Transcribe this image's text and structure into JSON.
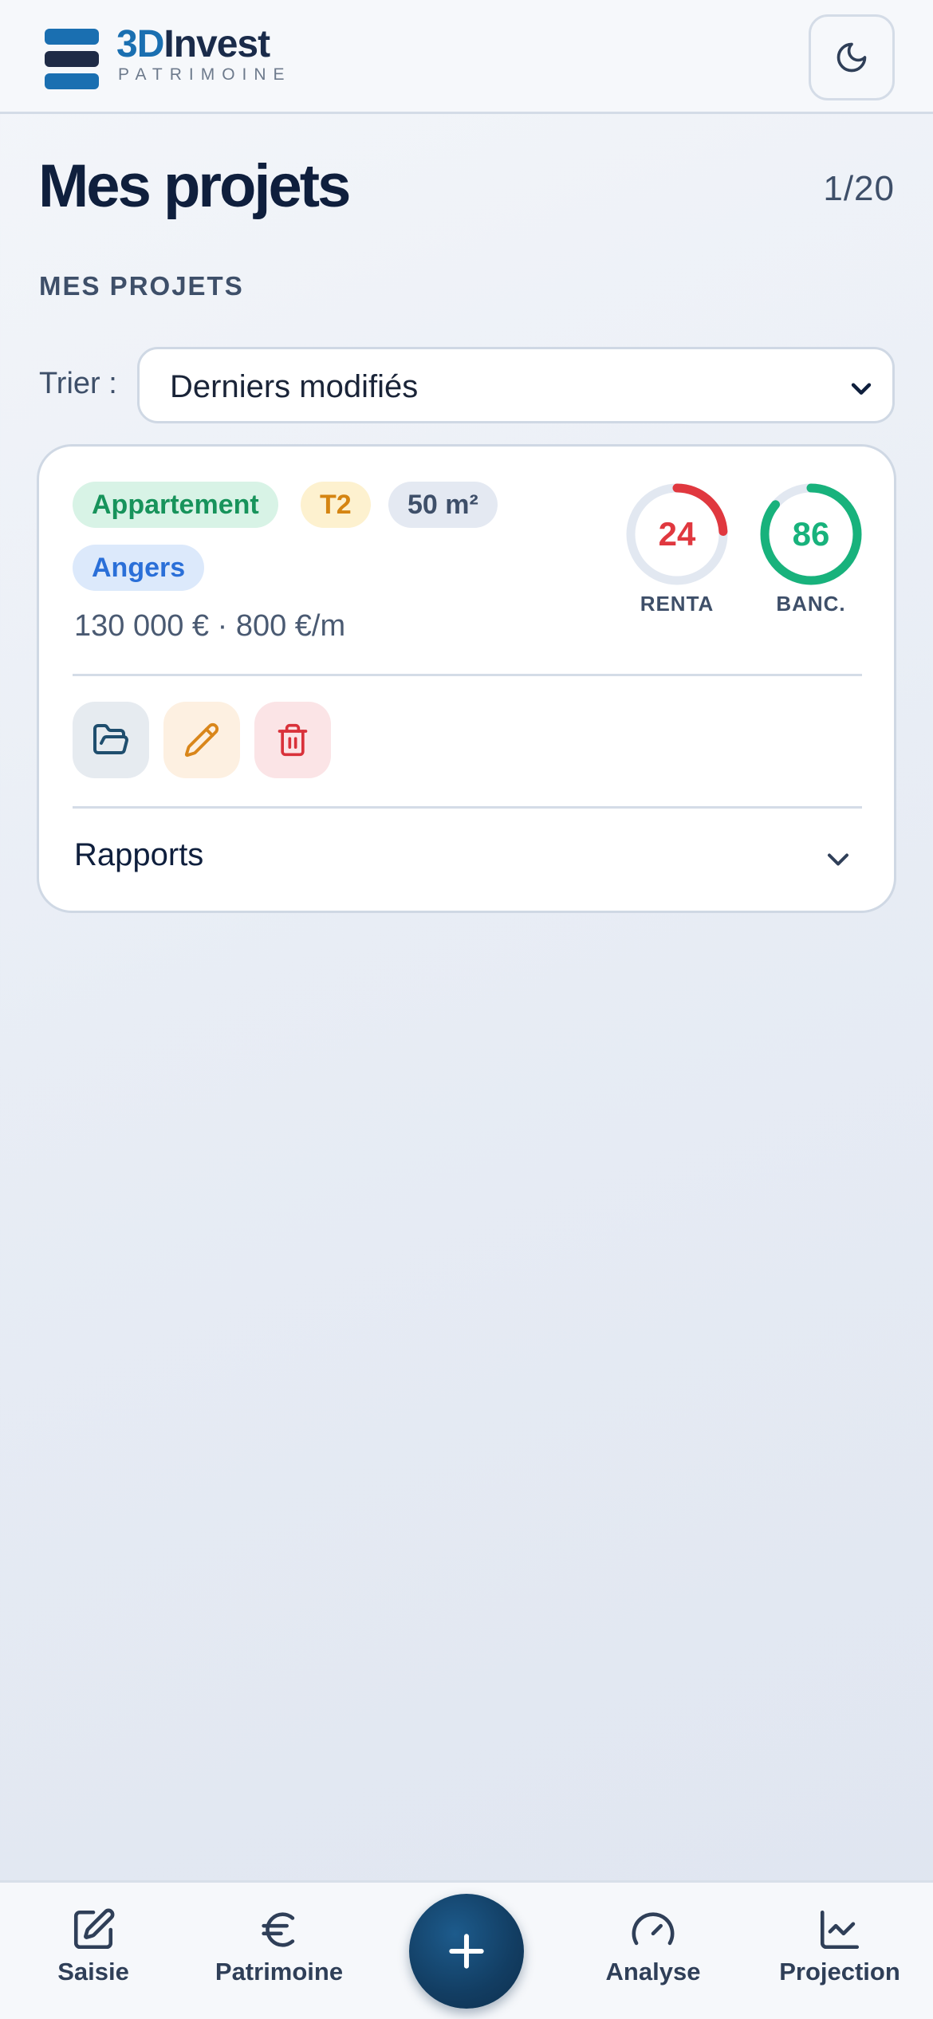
{
  "header": {
    "brand_prefix": "3D",
    "brand_name": "Invest",
    "brand_sub": "PATRIMOINE",
    "theme_icon": "moon-icon"
  },
  "page": {
    "title": "Mes projets",
    "counter": "1/20",
    "section_label": "MES PROJETS"
  },
  "sort": {
    "label": "Trier :",
    "selected": "Derniers modifiés"
  },
  "project_card": {
    "tags": {
      "type": "Appartement",
      "rooms": "T2",
      "area": "50 m²",
      "city": "Angers"
    },
    "price_line": "130 000 € · 800 €/m",
    "gauges": [
      {
        "value": "24",
        "score": 24,
        "label": "RENTA",
        "color": "#e0383f"
      },
      {
        "value": "86",
        "score": 86,
        "label": "BANC.",
        "color": "#18b27c"
      }
    ],
    "actions": [
      {
        "icon": "folder-open-icon"
      },
      {
        "icon": "pencil-icon"
      },
      {
        "icon": "trash-icon"
      }
    ],
    "reports_label": "Rapports"
  },
  "bottom_nav": {
    "items": [
      {
        "label": "Saisie",
        "icon": "edit-icon"
      },
      {
        "label": "Patrimoine",
        "icon": "euro-icon"
      },
      {
        "label": "Analyse",
        "icon": "gauge-icon"
      },
      {
        "label": "Projection",
        "icon": "line-chart-icon"
      }
    ],
    "fab_icon": "plus-icon"
  },
  "colors": {
    "brand_dark": "#1a2b4a",
    "brand_blue": "#1a6fb1",
    "renta": "#e0383f",
    "banc": "#18b27c",
    "fab": "#123d62"
  }
}
